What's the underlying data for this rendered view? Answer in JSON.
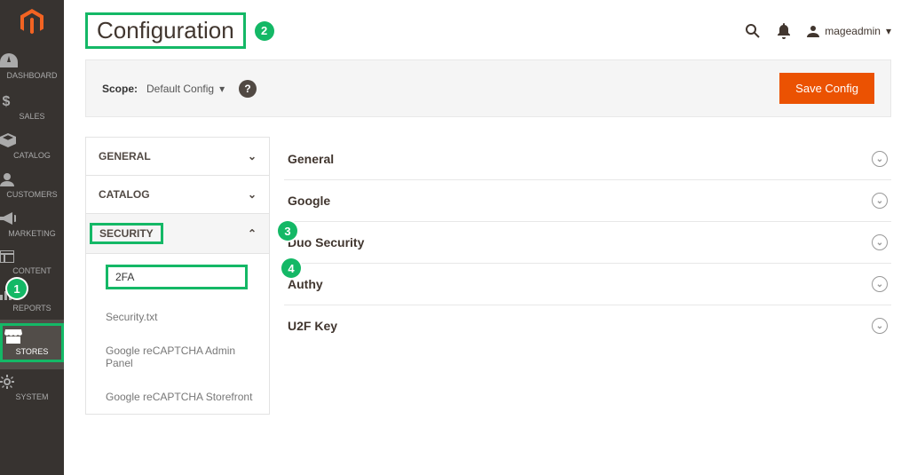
{
  "sidebar": {
    "items": [
      {
        "label": "DASHBOARD"
      },
      {
        "label": "SALES"
      },
      {
        "label": "CATALOG"
      },
      {
        "label": "CUSTOMERS"
      },
      {
        "label": "MARKETING"
      },
      {
        "label": "CONTENT"
      },
      {
        "label": "REPORTS"
      },
      {
        "label": "STORES"
      },
      {
        "label": "SYSTEM"
      }
    ]
  },
  "page": {
    "title": "Configuration"
  },
  "header": {
    "username": "mageadmin"
  },
  "scope": {
    "label": "Scope:",
    "value": "Default Config"
  },
  "actions": {
    "save": "Save Config"
  },
  "tabs": {
    "general": "GENERAL",
    "catalog": "CATALOG",
    "security": "SECURITY",
    "security_items": [
      {
        "label": "2FA"
      },
      {
        "label": "Security.txt"
      },
      {
        "label": "Google reCAPTCHA Admin Panel"
      },
      {
        "label": "Google reCAPTCHA Storefront"
      }
    ]
  },
  "sections": [
    {
      "label": "General"
    },
    {
      "label": "Google"
    },
    {
      "label": "Duo Security"
    },
    {
      "label": "Authy"
    },
    {
      "label": "U2F Key"
    }
  ],
  "callouts": {
    "c1": "1",
    "c2": "2",
    "c3": "3",
    "c4": "4"
  }
}
